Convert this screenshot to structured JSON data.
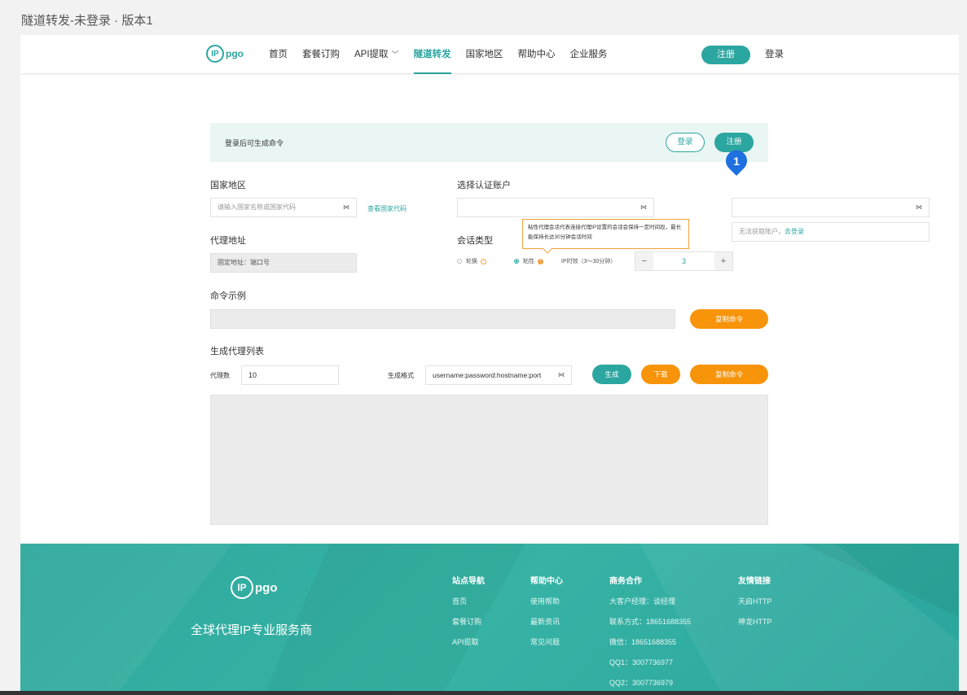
{
  "page_title": "隧道转发-未登录 · 版本1",
  "header": {
    "logo_circle": "IP",
    "logo_text": "pgo",
    "nav": [
      {
        "label": "首页"
      },
      {
        "label": "套餐订购"
      },
      {
        "label": "API提取"
      },
      {
        "label": "隧道转发"
      },
      {
        "label": "国家地区"
      },
      {
        "label": "帮助中心"
      },
      {
        "label": "企业服务"
      }
    ],
    "register": "注册",
    "login": "登录"
  },
  "banner": {
    "text": "登录后可生成命令",
    "login": "登录",
    "register": "注册"
  },
  "marker": "1",
  "form": {
    "country_label": "国家地区",
    "country_placeholder": "请输入国家名称或国家代码",
    "country_link": "查看国家代码",
    "auth_label": "选择认证账户",
    "no_account_text": "无法获取账户，",
    "go_login": "去登录",
    "proxy_addr_label": "代理地址",
    "proxy_addr_value": "固定地址：端口号",
    "session_label": "会话类型",
    "session_rotate": "轮换",
    "session_sticky": "粘性",
    "ip_duration_label": "IP时效（3～30分钟）",
    "ip_duration_value": "3",
    "tooltip": "粘性代理会话代表连接代理IP设置的会话会保持一定时间段，最长能保持长达30分钟会话时间",
    "cmd_example_label": "命令示例",
    "copy_cmd": "复制命令",
    "gen_list_label": "生成代理列表",
    "proxy_count_label": "代理数",
    "proxy_count_value": "10",
    "gen_format_label": "生成格式",
    "gen_format_value": "username:password:hostname:port",
    "generate": "生成",
    "download": "下载",
    "copy_cmd2": "复制命令"
  },
  "footer": {
    "logo_circle": "IP",
    "logo_text": "pgo",
    "slogan": "全球代理IP专业服务商",
    "columns": [
      {
        "title": "站点导航",
        "items": [
          "首页",
          "套餐订购",
          "API提取"
        ]
      },
      {
        "title": "帮助中心",
        "items": [
          "使用帮助",
          "最新资讯",
          "常见问题"
        ]
      },
      {
        "title": "商务合作",
        "items": [
          "大客户经理：谈经理",
          "联系方式：18651688355",
          "微信：18651688355",
          "QQ1：3007736977",
          "QQ2：3007736979"
        ]
      },
      {
        "title": "友情链接",
        "items": [
          "天启HTTP",
          "神龙HTTP"
        ]
      }
    ]
  },
  "colors": {
    "brand": "#2ba6a0",
    "orange": "#f7940a",
    "marker": "#1e6fe0"
  }
}
